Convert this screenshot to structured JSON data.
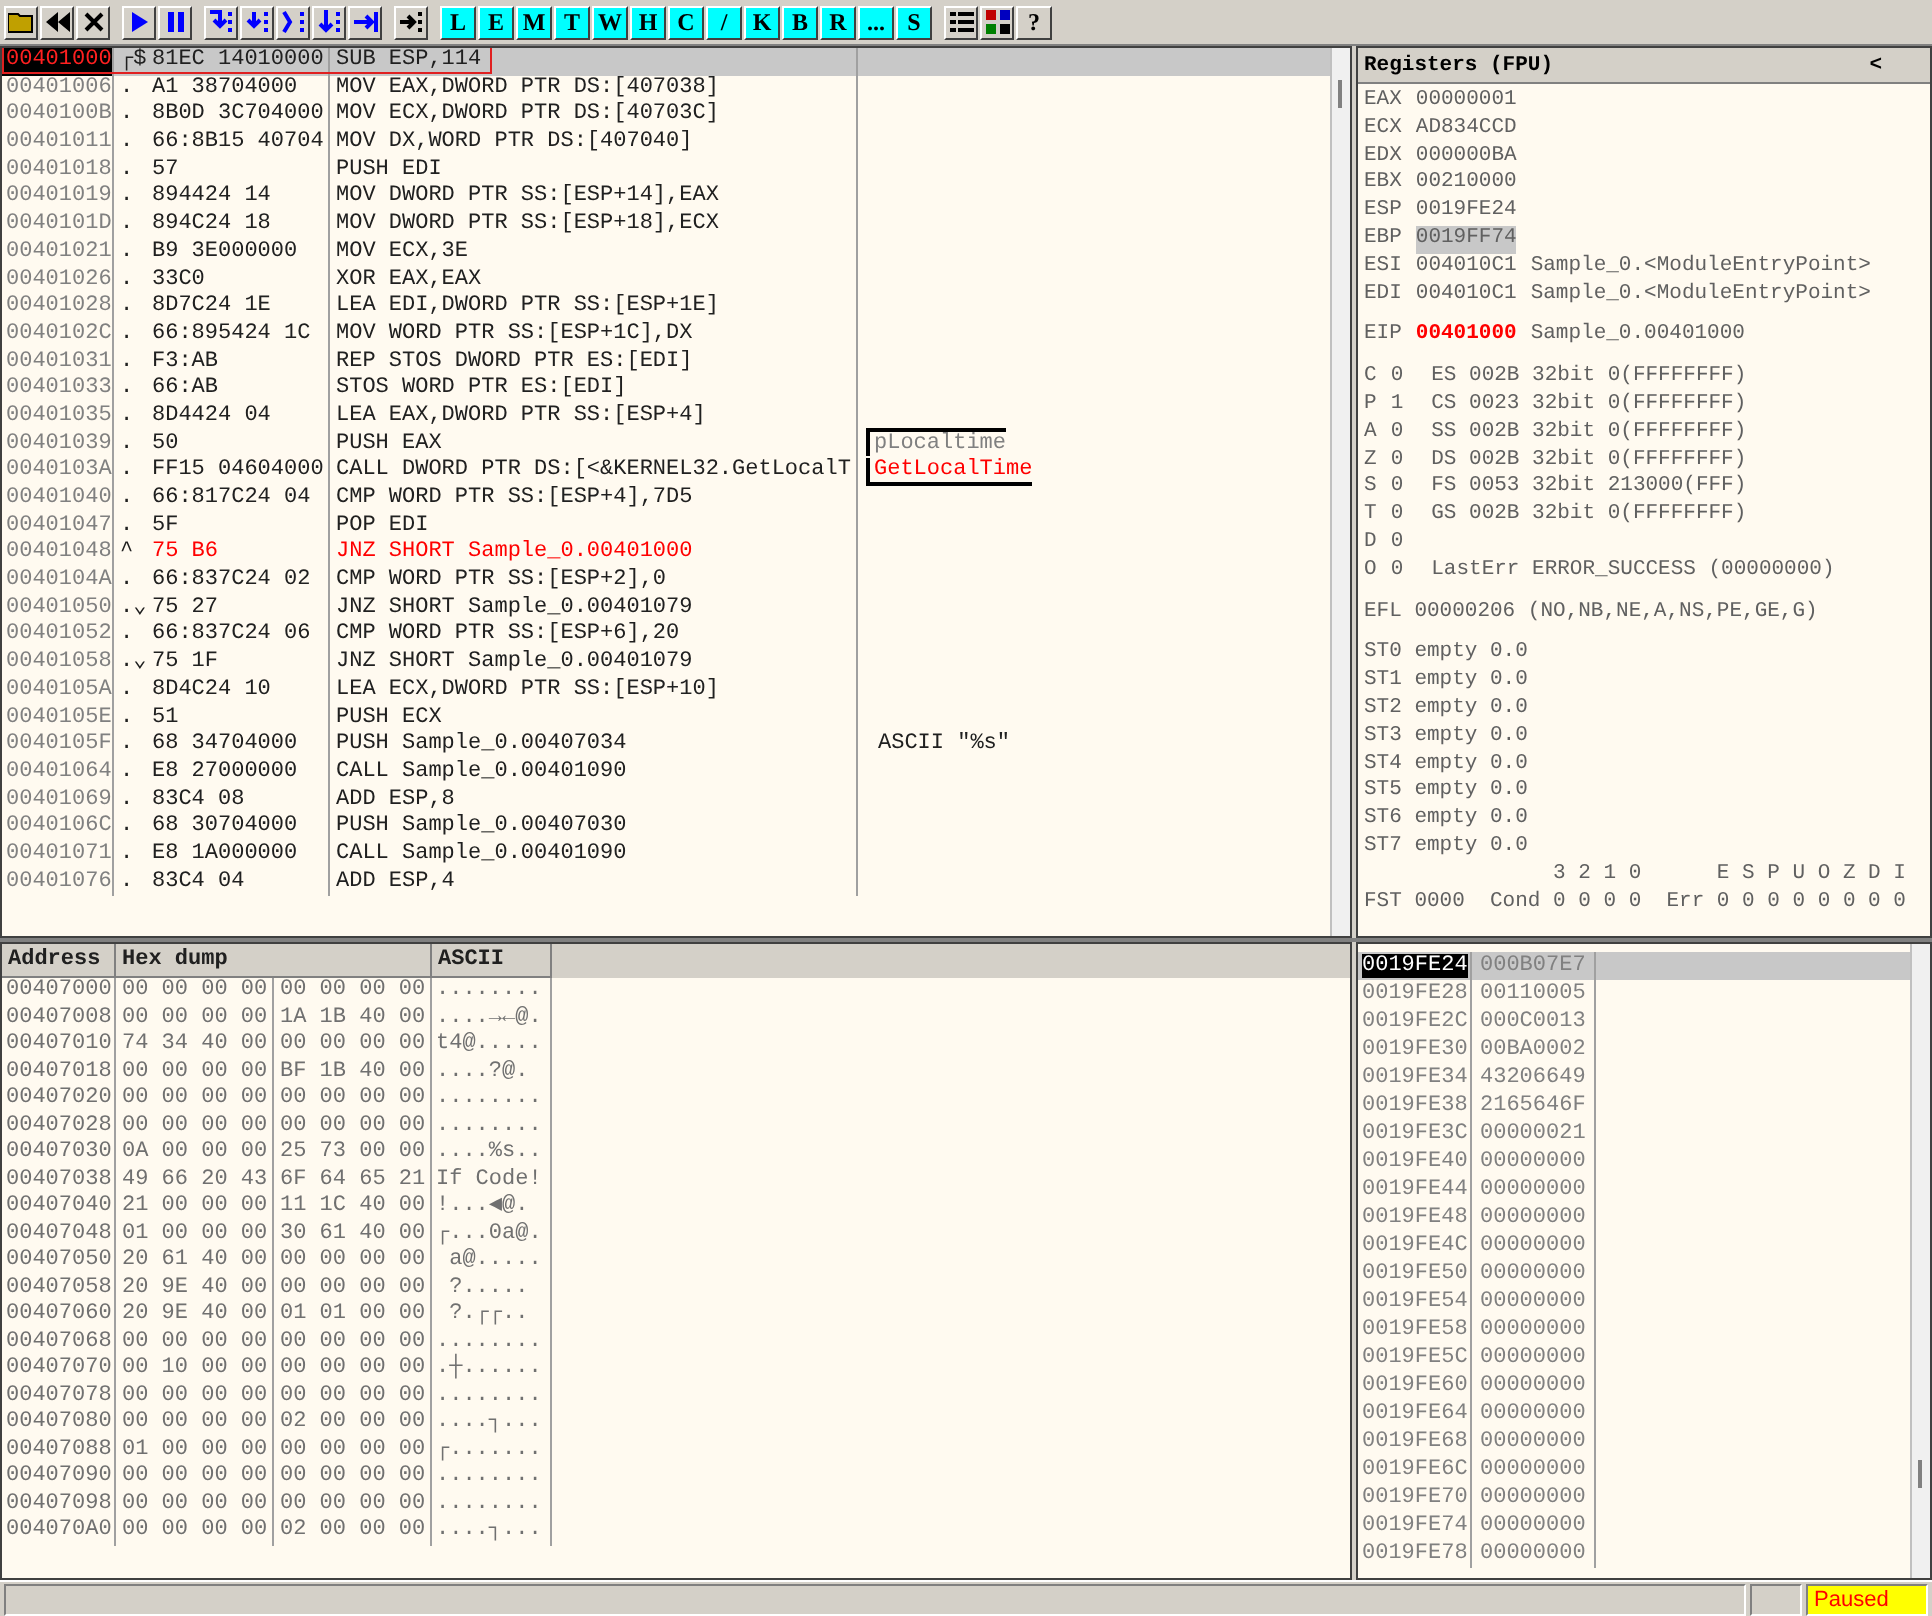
{
  "toolbar": {
    "letter_buttons": [
      "L",
      "E",
      "M",
      "T",
      "W",
      "H",
      "C",
      "/",
      "K",
      "B",
      "R",
      "...",
      "S"
    ],
    "help": "?"
  },
  "disassembly": {
    "rows": [
      {
        "address": "00401000",
        "mark": "┌$",
        "hex": "81EC 14010000",
        "instruction": "SUB ESP,114",
        "selected": true,
        "eip": true,
        "jump_taken": false
      },
      {
        "address": "00401006",
        "mark": ".",
        "hex": "A1 38704000",
        "instruction": "MOV EAX,DWORD PTR DS:[407038]",
        "selected": false,
        "eip": false,
        "jump_taken": false
      },
      {
        "address": "0040100B",
        "mark": ".",
        "hex": "8B0D 3C704000",
        "instruction": "MOV ECX,DWORD PTR DS:[40703C]",
        "selected": false,
        "eip": false,
        "jump_taken": false
      },
      {
        "address": "00401011",
        "mark": ".",
        "hex": "66:8B15 40704",
        "instruction": "MOV DX,WORD PTR DS:[407040]",
        "selected": false,
        "eip": false,
        "jump_taken": false
      },
      {
        "address": "00401018",
        "mark": ".",
        "hex": "57",
        "instruction": "PUSH EDI",
        "selected": false,
        "eip": false,
        "jump_taken": false
      },
      {
        "address": "00401019",
        "mark": ".",
        "hex": "894424 14",
        "instruction": "MOV DWORD PTR SS:[ESP+14],EAX",
        "selected": false,
        "eip": false,
        "jump_taken": false
      },
      {
        "address": "0040101D",
        "mark": ".",
        "hex": "894C24 18",
        "instruction": "MOV DWORD PTR SS:[ESP+18],ECX",
        "selected": false,
        "eip": false,
        "jump_taken": false
      },
      {
        "address": "00401021",
        "mark": ".",
        "hex": "B9 3E000000",
        "instruction": "MOV ECX,3E",
        "selected": false,
        "eip": false,
        "jump_taken": false
      },
      {
        "address": "00401026",
        "mark": ".",
        "hex": "33C0",
        "instruction": "XOR EAX,EAX",
        "selected": false,
        "eip": false,
        "jump_taken": false
      },
      {
        "address": "00401028",
        "mark": ".",
        "hex": "8D7C24 1E",
        "instruction": "LEA EDI,DWORD PTR SS:[ESP+1E]",
        "selected": false,
        "eip": false,
        "jump_taken": false
      },
      {
        "address": "0040102C",
        "mark": ".",
        "hex": "66:895424 1C",
        "instruction": "MOV WORD PTR SS:[ESP+1C],DX",
        "selected": false,
        "eip": false,
        "jump_taken": false
      },
      {
        "address": "00401031",
        "mark": ".",
        "hex": "F3:AB",
        "instruction": "REP STOS DWORD PTR ES:[EDI]",
        "selected": false,
        "eip": false,
        "jump_taken": false
      },
      {
        "address": "00401033",
        "mark": ".",
        "hex": "66:AB",
        "instruction": "STOS WORD PTR ES:[EDI]",
        "selected": false,
        "eip": false,
        "jump_taken": false
      },
      {
        "address": "00401035",
        "mark": ".",
        "hex": "8D4424 04",
        "instruction": "LEA EAX,DWORD PTR SS:[ESP+4]",
        "selected": false,
        "eip": false,
        "jump_taken": false
      },
      {
        "address": "00401039",
        "mark": ".",
        "hex": "50",
        "instruction": "PUSH EAX",
        "comment": {
          "kind": "arg",
          "text": "pLocaltime"
        },
        "selected": false,
        "eip": false,
        "jump_taken": false
      },
      {
        "address": "0040103A",
        "mark": ".",
        "hex": "FF15 04604000",
        "instruction": "CALL DWORD PTR DS:[<&KERNEL32.GetLocalT",
        "comment": {
          "kind": "api",
          "text": "GetLocalTime"
        },
        "selected": false,
        "eip": false,
        "jump_taken": false
      },
      {
        "address": "00401040",
        "mark": ".",
        "hex": "66:817C24 04",
        "instruction": "CMP WORD PTR SS:[ESP+4],7D5",
        "selected": false,
        "eip": false,
        "jump_taken": false
      },
      {
        "address": "00401047",
        "mark": ".",
        "hex": "5F",
        "instruction": "POP EDI",
        "selected": false,
        "eip": false,
        "jump_taken": false
      },
      {
        "address": "00401048",
        "mark": "^",
        "hex": "75 B6",
        "instruction": "JNZ SHORT Sample_0.00401000",
        "selected": false,
        "eip": false,
        "jump_taken": true
      },
      {
        "address": "0040104A",
        "mark": ".",
        "hex": "66:837C24 02",
        "instruction": "CMP WORD PTR SS:[ESP+2],0",
        "selected": false,
        "eip": false,
        "jump_taken": false
      },
      {
        "address": "00401050",
        "mark": ".⌄",
        "hex": "75 27",
        "instruction": "JNZ SHORT Sample_0.00401079",
        "selected": false,
        "eip": false,
        "jump_taken": false
      },
      {
        "address": "00401052",
        "mark": ".",
        "hex": "66:837C24 06",
        "instruction": "CMP WORD PTR SS:[ESP+6],20",
        "selected": false,
        "eip": false,
        "jump_taken": false
      },
      {
        "address": "00401058",
        "mark": ".⌄",
        "hex": "75 1F",
        "instruction": "JNZ SHORT Sample_0.00401079",
        "selected": false,
        "eip": false,
        "jump_taken": false
      },
      {
        "address": "0040105A",
        "mark": ".",
        "hex": "8D4C24 10",
        "instruction": "LEA ECX,DWORD PTR SS:[ESP+10]",
        "selected": false,
        "eip": false,
        "jump_taken": false
      },
      {
        "address": "0040105E",
        "mark": ".",
        "hex": "51",
        "instruction": "PUSH ECX",
        "selected": false,
        "eip": false,
        "jump_taken": false
      },
      {
        "address": "0040105F",
        "mark": ".",
        "hex": "68 34704000",
        "instruction": "PUSH Sample_0.00407034",
        "comment": {
          "kind": "note",
          "text": "ASCII \"%s\""
        },
        "selected": false,
        "eip": false,
        "jump_taken": false
      },
      {
        "address": "00401064",
        "mark": ".",
        "hex": "E8 27000000",
        "instruction": "CALL Sample_0.00401090",
        "selected": false,
        "eip": false,
        "jump_taken": false
      },
      {
        "address": "00401069",
        "mark": ".",
        "hex": "83C4 08",
        "instruction": "ADD ESP,8",
        "selected": false,
        "eip": false,
        "jump_taken": false
      },
      {
        "address": "0040106C",
        "mark": ".",
        "hex": "68 30704000",
        "instruction": "PUSH Sample_0.00407030",
        "selected": false,
        "eip": false,
        "jump_taken": false
      },
      {
        "address": "00401071",
        "mark": ".",
        "hex": "E8 1A000000",
        "instruction": "CALL Sample_0.00401090",
        "selected": false,
        "eip": false,
        "jump_taken": false
      },
      {
        "address": "00401076",
        "mark": ".",
        "hex": "83C4 04",
        "instruction": "ADD ESP,4",
        "selected": false,
        "eip": false,
        "jump_taken": false
      }
    ]
  },
  "registers": {
    "title": "Registers (FPU)",
    "arrow": "<",
    "general": [
      {
        "name": "EAX",
        "value": "00000001",
        "selected": false
      },
      {
        "name": "ECX",
        "value": "AD834CCD",
        "selected": false
      },
      {
        "name": "EDX",
        "value": "000000BA",
        "selected": false
      },
      {
        "name": "EBX",
        "value": "00210000",
        "selected": false
      },
      {
        "name": "ESP",
        "value": "0019FE24",
        "selected": false
      },
      {
        "name": "EBP",
        "value": "0019FF74",
        "selected": true
      },
      {
        "name": "ESI",
        "value": "004010C1",
        "note": "Sample_0.<ModuleEntryPoint>",
        "selected": false
      },
      {
        "name": "EDI",
        "value": "004010C1",
        "note": "Sample_0.<ModuleEntryPoint>",
        "selected": false
      }
    ],
    "eip": {
      "name": "EIP",
      "value": "00401000",
      "note": "Sample_0.00401000",
      "changed": true
    },
    "flags": [
      {
        "flag": "C",
        "bit": "0",
        "text": "ES 002B 32bit 0(FFFFFFFF)"
      },
      {
        "flag": "P",
        "bit": "1",
        "text": "CS 0023 32bit 0(FFFFFFFF)"
      },
      {
        "flag": "A",
        "bit": "0",
        "text": "SS 002B 32bit 0(FFFFFFFF)"
      },
      {
        "flag": "Z",
        "bit": "0",
        "text": "DS 002B 32bit 0(FFFFFFFF)"
      },
      {
        "flag": "S",
        "bit": "0",
        "text": "FS 0053 32bit 213000(FFF)"
      },
      {
        "flag": "T",
        "bit": "0",
        "text": "GS 002B 32bit 0(FFFFFFFF)"
      },
      {
        "flag": "D",
        "bit": "0"
      },
      {
        "flag": "O",
        "bit": "0",
        "text": "LastErr ERROR_SUCCESS (00000000)"
      }
    ],
    "efl": "EFL 00000206 (NO,NB,NE,A,NS,PE,GE,G)",
    "fpu": [
      "ST0 empty 0.0",
      "ST1 empty 0.0",
      "ST2 empty 0.0",
      "ST3 empty 0.0",
      "ST4 empty 0.0",
      "ST5 empty 0.0",
      "ST6 empty 0.0",
      "ST7 empty 0.0"
    ],
    "fst_header": "               3 2 1 0      E S P U O Z D I",
    "fst": "FST 0000  Cond 0 0 0 0  Err 0 0 0 0 0 0 0 0"
  },
  "dump": {
    "columns": [
      "Address",
      "Hex dump",
      "ASCII"
    ],
    "rows": [
      {
        "address": "00407000",
        "hex": [
          "00 00 00 00",
          "00 00 00 00"
        ],
        "ascii": "........"
      },
      {
        "address": "00407008",
        "hex": [
          "00 00 00 00",
          "1A 1B 40 00"
        ],
        "ascii": "....→←@."
      },
      {
        "address": "00407010",
        "hex": [
          "74 34 40 00",
          "00 00 00 00"
        ],
        "ascii": "t4@....."
      },
      {
        "address": "00407018",
        "hex": [
          "00 00 00 00",
          "BF 1B 40 00"
        ],
        "ascii": "....?@."
      },
      {
        "address": "00407020",
        "hex": [
          "00 00 00 00",
          "00 00 00 00"
        ],
        "ascii": "........"
      },
      {
        "address": "00407028",
        "hex": [
          "00 00 00 00",
          "00 00 00 00"
        ],
        "ascii": "........"
      },
      {
        "address": "00407030",
        "hex": [
          "0A 00 00 00",
          "25 73 00 00"
        ],
        "ascii": "....%s.."
      },
      {
        "address": "00407038",
        "hex": [
          "49 66 20 43",
          "6F 64 65 21"
        ],
        "ascii": "If Code!"
      },
      {
        "address": "00407040",
        "hex": [
          "21 00 00 00",
          "11 1C 40 00"
        ],
        "ascii": "!...◀@."
      },
      {
        "address": "00407048",
        "hex": [
          "01 00 00 00",
          "30 61 40 00"
        ],
        "ascii": "┌...0a@."
      },
      {
        "address": "00407050",
        "hex": [
          "20 61 40 00",
          "00 00 00 00"
        ],
        "ascii": " a@....."
      },
      {
        "address": "00407058",
        "hex": [
          "20 9E 40 00",
          "00 00 00 00"
        ],
        "ascii": " ?....."
      },
      {
        "address": "00407060",
        "hex": [
          "20 9E 40 00",
          "01 01 00 00"
        ],
        "ascii": " ?.┌┌.."
      },
      {
        "address": "00407068",
        "hex": [
          "00 00 00 00",
          "00 00 00 00"
        ],
        "ascii": "........"
      },
      {
        "address": "00407070",
        "hex": [
          "00 10 00 00",
          "00 00 00 00"
        ],
        "ascii": ".┼......"
      },
      {
        "address": "00407078",
        "hex": [
          "00 00 00 00",
          "00 00 00 00"
        ],
        "ascii": "........"
      },
      {
        "address": "00407080",
        "hex": [
          "00 00 00 00",
          "02 00 00 00"
        ],
        "ascii": "....┐..."
      },
      {
        "address": "00407088",
        "hex": [
          "01 00 00 00",
          "00 00 00 00"
        ],
        "ascii": "┌......."
      },
      {
        "address": "00407090",
        "hex": [
          "00 00 00 00",
          "00 00 00 00"
        ],
        "ascii": "........"
      },
      {
        "address": "00407098",
        "hex": [
          "00 00 00 00",
          "00 00 00 00"
        ],
        "ascii": "........"
      },
      {
        "address": "004070A0",
        "hex": [
          "00 00 00 00",
          "02 00 00 00"
        ],
        "ascii": "....┐..."
      }
    ]
  },
  "stack": {
    "rows": [
      {
        "address": "0019FE24",
        "value": "000B07E7",
        "selected": true
      },
      {
        "address": "0019FE28",
        "value": "00110005",
        "selected": false
      },
      {
        "address": "0019FE2C",
        "value": "000C0013",
        "selected": false
      },
      {
        "address": "0019FE30",
        "value": "00BA0002",
        "selected": false
      },
      {
        "address": "0019FE34",
        "value": "43206649",
        "selected": false
      },
      {
        "address": "0019FE38",
        "value": "2165646F",
        "selected": false
      },
      {
        "address": "0019FE3C",
        "value": "00000021",
        "selected": false
      },
      {
        "address": "0019FE40",
        "value": "00000000",
        "selected": false
      },
      {
        "address": "0019FE44",
        "value": "00000000",
        "selected": false
      },
      {
        "address": "0019FE48",
        "value": "00000000",
        "selected": false
      },
      {
        "address": "0019FE4C",
        "value": "00000000",
        "selected": false
      },
      {
        "address": "0019FE50",
        "value": "00000000",
        "selected": false
      },
      {
        "address": "0019FE54",
        "value": "00000000",
        "selected": false
      },
      {
        "address": "0019FE58",
        "value": "00000000",
        "selected": false
      },
      {
        "address": "0019FE5C",
        "value": "00000000",
        "selected": false
      },
      {
        "address": "0019FE60",
        "value": "00000000",
        "selected": false
      },
      {
        "address": "0019FE64",
        "value": "00000000",
        "selected": false
      },
      {
        "address": "0019FE68",
        "value": "00000000",
        "selected": false
      },
      {
        "address": "0019FE6C",
        "value": "00000000",
        "selected": false
      },
      {
        "address": "0019FE70",
        "value": "00000000",
        "selected": false
      },
      {
        "address": "0019FE74",
        "value": "00000000",
        "selected": false
      },
      {
        "address": "0019FE78",
        "value": "00000000",
        "selected": false
      }
    ]
  },
  "status_bar": {
    "state": "Paused"
  }
}
